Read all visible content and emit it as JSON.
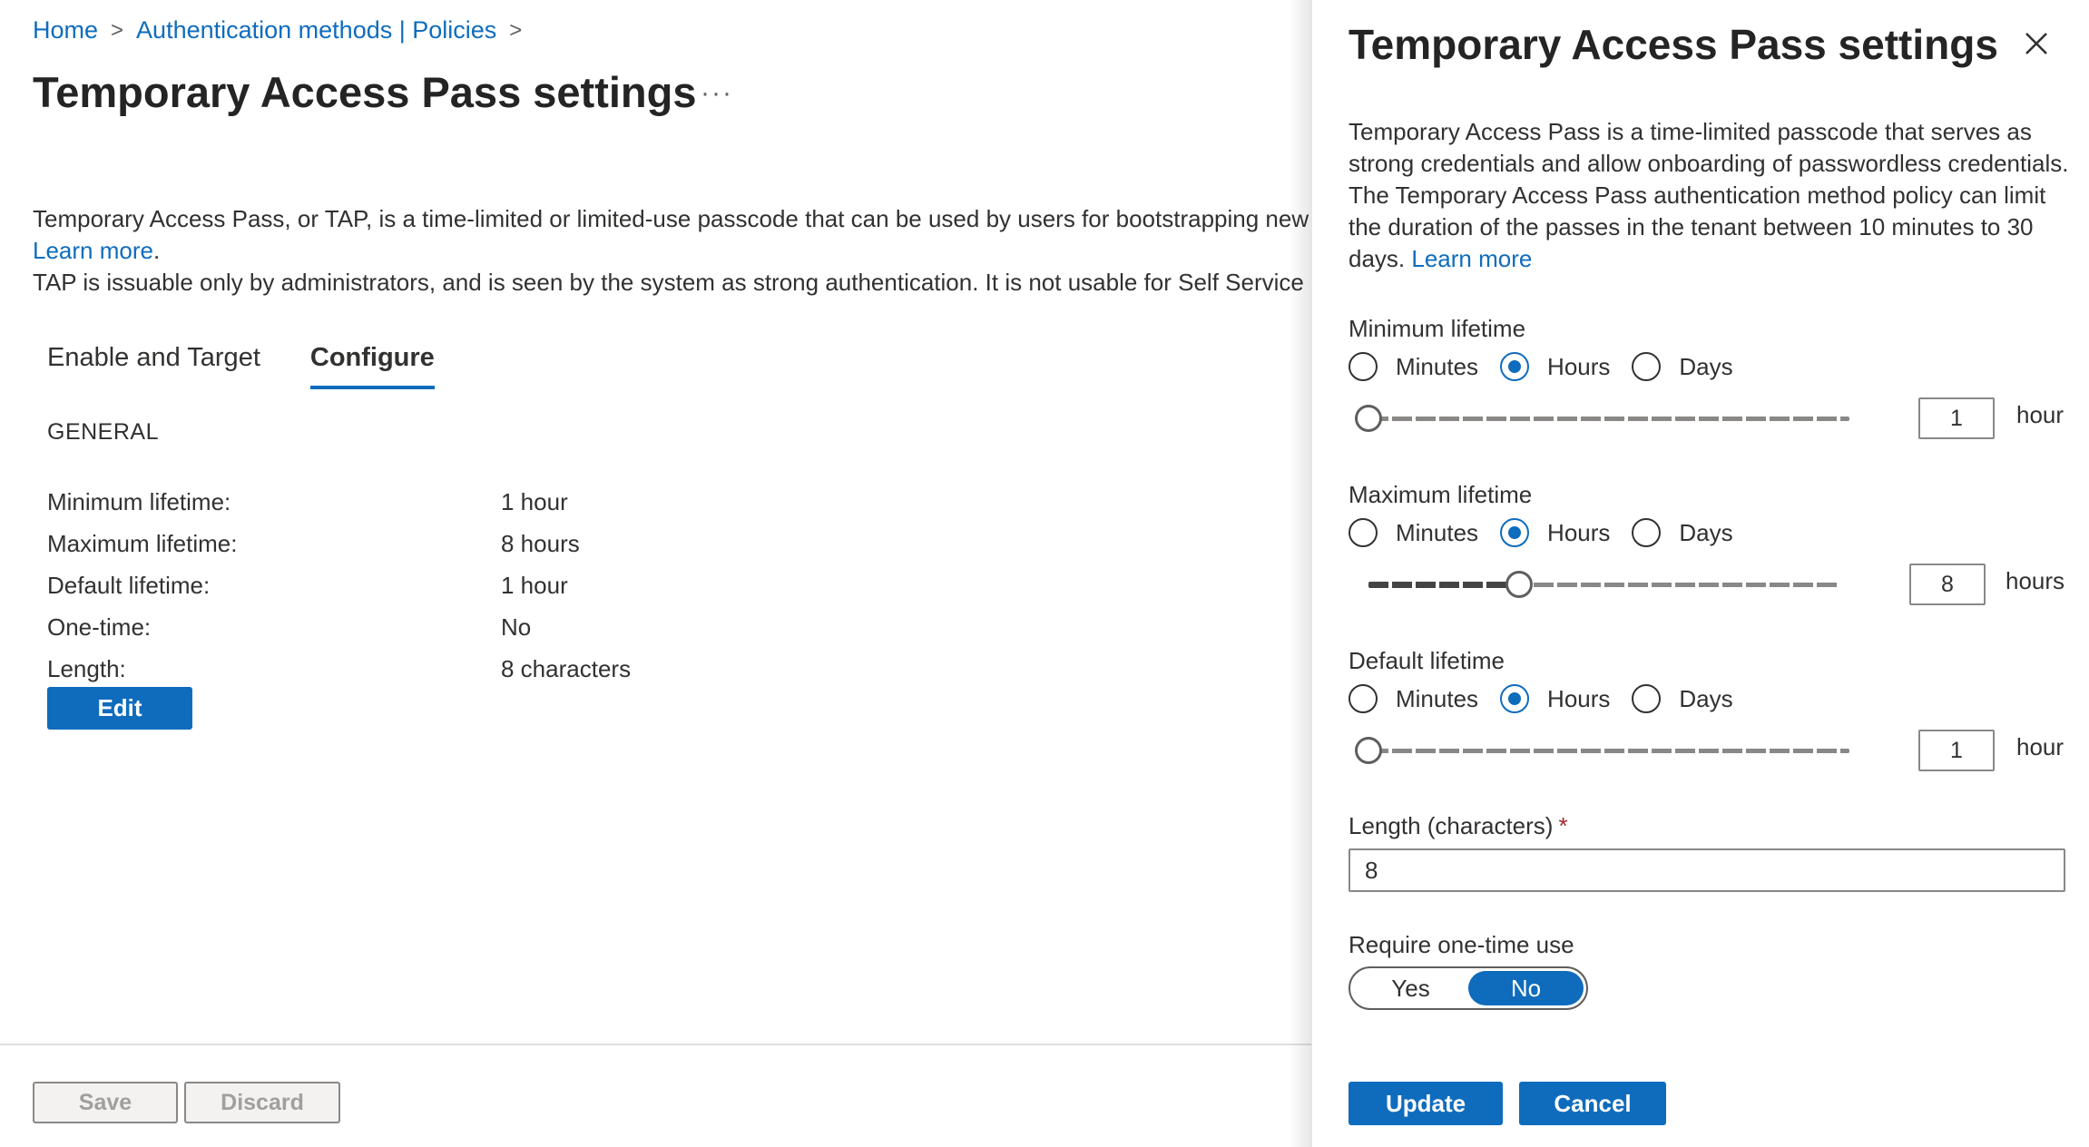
{
  "breadcrumb": {
    "home": "Home",
    "separator": ">",
    "policies": "Authentication methods | Policies"
  },
  "page": {
    "title": "Temporary Access Pass settings",
    "more": "···",
    "description_line1": "Temporary Access Pass, or TAP, is a time-limited or limited-use passcode that can be used by users for bootstrapping new a",
    "learn_more": "Learn more",
    "period": ".",
    "description_line2": "TAP is issuable only by administrators, and is seen by the system as strong authentication. It is not usable for Self Service Pa"
  },
  "tabs": [
    {
      "label": "Enable and Target",
      "active": false
    },
    {
      "label": "Configure",
      "active": true
    }
  ],
  "general": {
    "header": "GENERAL",
    "rows": [
      {
        "label": "Minimum lifetime:",
        "value": "1 hour"
      },
      {
        "label": "Maximum lifetime:",
        "value": "8 hours"
      },
      {
        "label": "Default lifetime:",
        "value": "1 hour"
      },
      {
        "label": "One-time:",
        "value": "No"
      },
      {
        "label": "Length:",
        "value": "8 characters"
      }
    ],
    "edit_label": "Edit"
  },
  "footer": {
    "save_label": "Save",
    "discard_label": "Discard"
  },
  "panel": {
    "title": "Temporary Access Pass settings",
    "description": "Temporary Access Pass is a time-limited passcode that serves as strong credentials and allow onboarding of passwordless credentials. The Temporary Access Pass authentication method policy can limit the duration of the passes in the tenant between 10 minutes to 30 days.",
    "learn_more": "Learn more",
    "radio_options": [
      "Minutes",
      "Hours",
      "Days"
    ],
    "minimum": {
      "label": "Minimum lifetime",
      "selected": "Hours",
      "slider_fraction": 0.0,
      "value": "1",
      "unit": "hour"
    },
    "maximum": {
      "label": "Maximum lifetime",
      "selected": "Hours",
      "slider_fraction": 0.32,
      "value": "8",
      "unit": "hours"
    },
    "default": {
      "label": "Default lifetime",
      "selected": "Hours",
      "slider_fraction": 0.0,
      "value": "1",
      "unit": "hour"
    },
    "length": {
      "label": "Length (characters)",
      "required_mark": "*",
      "value": "8"
    },
    "one_time": {
      "label": "Require one-time use",
      "yes": "Yes",
      "no": "No",
      "selected": "No"
    },
    "update_label": "Update",
    "cancel_label": "Cancel"
  },
  "colors": {
    "accent": "#0f6cbd",
    "required": "#a4262c",
    "disabled_text": "#a19f9d"
  }
}
